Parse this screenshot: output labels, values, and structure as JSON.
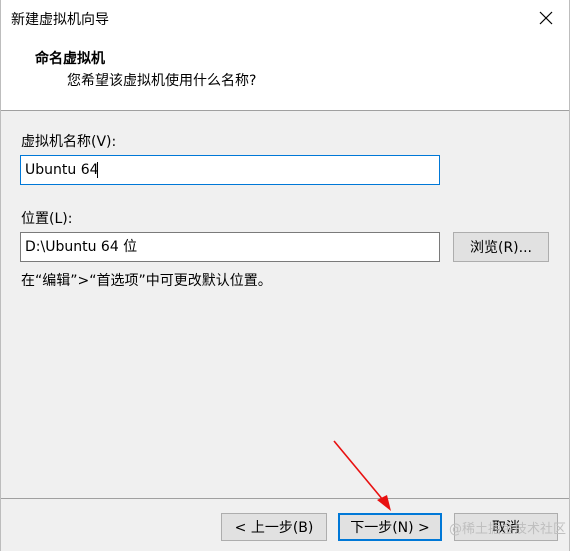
{
  "window": {
    "title": "新建虚拟机向导",
    "close_icon": "close-icon"
  },
  "header": {
    "title": "命名虚拟机",
    "subtitle": "您希望该虚拟机使用什么名称?"
  },
  "form": {
    "vm_name_label": "虚拟机名称(V):",
    "vm_name_value": "Ubuntu 64",
    "location_label": "位置(L):",
    "location_value": "D:\\Ubuntu 64 位",
    "browse_label": "浏览(R)...",
    "hint": "在“编辑”>“首选项”中可更改默认位置。"
  },
  "footer": {
    "back_label": "< 上一步(B)",
    "next_label": "下一步(N) >",
    "cancel_label": "取消"
  },
  "overlay": {
    "watermark": "@稀土掘金技术社区",
    "arrow_color": "#e81010"
  }
}
